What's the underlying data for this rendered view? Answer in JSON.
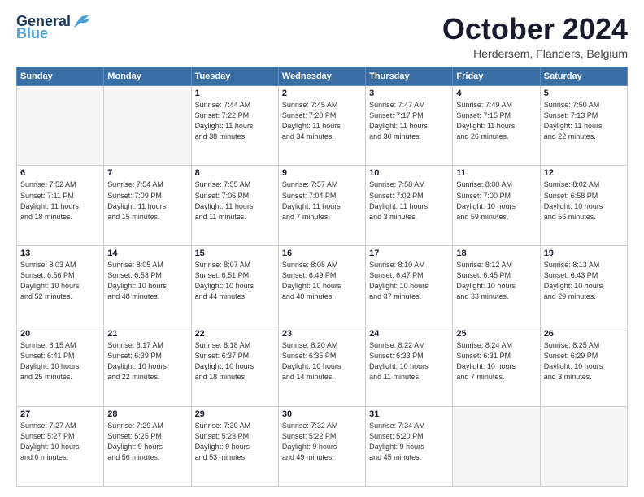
{
  "logo": {
    "line1": "General",
    "line1_accent": "Blue",
    "tagline": ""
  },
  "header": {
    "month": "October 2024",
    "location": "Herdersem, Flanders, Belgium"
  },
  "weekdays": [
    "Sunday",
    "Monday",
    "Tuesday",
    "Wednesday",
    "Thursday",
    "Friday",
    "Saturday"
  ],
  "weeks": [
    [
      {
        "day": "",
        "info": ""
      },
      {
        "day": "",
        "info": ""
      },
      {
        "day": "1",
        "info": "Sunrise: 7:44 AM\nSunset: 7:22 PM\nDaylight: 11 hours\nand 38 minutes."
      },
      {
        "day": "2",
        "info": "Sunrise: 7:45 AM\nSunset: 7:20 PM\nDaylight: 11 hours\nand 34 minutes."
      },
      {
        "day": "3",
        "info": "Sunrise: 7:47 AM\nSunset: 7:17 PM\nDaylight: 11 hours\nand 30 minutes."
      },
      {
        "day": "4",
        "info": "Sunrise: 7:49 AM\nSunset: 7:15 PM\nDaylight: 11 hours\nand 26 minutes."
      },
      {
        "day": "5",
        "info": "Sunrise: 7:50 AM\nSunset: 7:13 PM\nDaylight: 11 hours\nand 22 minutes."
      }
    ],
    [
      {
        "day": "6",
        "info": "Sunrise: 7:52 AM\nSunset: 7:11 PM\nDaylight: 11 hours\nand 18 minutes."
      },
      {
        "day": "7",
        "info": "Sunrise: 7:54 AM\nSunset: 7:09 PM\nDaylight: 11 hours\nand 15 minutes."
      },
      {
        "day": "8",
        "info": "Sunrise: 7:55 AM\nSunset: 7:06 PM\nDaylight: 11 hours\nand 11 minutes."
      },
      {
        "day": "9",
        "info": "Sunrise: 7:57 AM\nSunset: 7:04 PM\nDaylight: 11 hours\nand 7 minutes."
      },
      {
        "day": "10",
        "info": "Sunrise: 7:58 AM\nSunset: 7:02 PM\nDaylight: 11 hours\nand 3 minutes."
      },
      {
        "day": "11",
        "info": "Sunrise: 8:00 AM\nSunset: 7:00 PM\nDaylight: 10 hours\nand 59 minutes."
      },
      {
        "day": "12",
        "info": "Sunrise: 8:02 AM\nSunset: 6:58 PM\nDaylight: 10 hours\nand 56 minutes."
      }
    ],
    [
      {
        "day": "13",
        "info": "Sunrise: 8:03 AM\nSunset: 6:56 PM\nDaylight: 10 hours\nand 52 minutes."
      },
      {
        "day": "14",
        "info": "Sunrise: 8:05 AM\nSunset: 6:53 PM\nDaylight: 10 hours\nand 48 minutes."
      },
      {
        "day": "15",
        "info": "Sunrise: 8:07 AM\nSunset: 6:51 PM\nDaylight: 10 hours\nand 44 minutes."
      },
      {
        "day": "16",
        "info": "Sunrise: 8:08 AM\nSunset: 6:49 PM\nDaylight: 10 hours\nand 40 minutes."
      },
      {
        "day": "17",
        "info": "Sunrise: 8:10 AM\nSunset: 6:47 PM\nDaylight: 10 hours\nand 37 minutes."
      },
      {
        "day": "18",
        "info": "Sunrise: 8:12 AM\nSunset: 6:45 PM\nDaylight: 10 hours\nand 33 minutes."
      },
      {
        "day": "19",
        "info": "Sunrise: 8:13 AM\nSunset: 6:43 PM\nDaylight: 10 hours\nand 29 minutes."
      }
    ],
    [
      {
        "day": "20",
        "info": "Sunrise: 8:15 AM\nSunset: 6:41 PM\nDaylight: 10 hours\nand 25 minutes."
      },
      {
        "day": "21",
        "info": "Sunrise: 8:17 AM\nSunset: 6:39 PM\nDaylight: 10 hours\nand 22 minutes."
      },
      {
        "day": "22",
        "info": "Sunrise: 8:18 AM\nSunset: 6:37 PM\nDaylight: 10 hours\nand 18 minutes."
      },
      {
        "day": "23",
        "info": "Sunrise: 8:20 AM\nSunset: 6:35 PM\nDaylight: 10 hours\nand 14 minutes."
      },
      {
        "day": "24",
        "info": "Sunrise: 8:22 AM\nSunset: 6:33 PM\nDaylight: 10 hours\nand 11 minutes."
      },
      {
        "day": "25",
        "info": "Sunrise: 8:24 AM\nSunset: 6:31 PM\nDaylight: 10 hours\nand 7 minutes."
      },
      {
        "day": "26",
        "info": "Sunrise: 8:25 AM\nSunset: 6:29 PM\nDaylight: 10 hours\nand 3 minutes."
      }
    ],
    [
      {
        "day": "27",
        "info": "Sunrise: 7:27 AM\nSunset: 5:27 PM\nDaylight: 10 hours\nand 0 minutes."
      },
      {
        "day": "28",
        "info": "Sunrise: 7:29 AM\nSunset: 5:25 PM\nDaylight: 9 hours\nand 56 minutes."
      },
      {
        "day": "29",
        "info": "Sunrise: 7:30 AM\nSunset: 5:23 PM\nDaylight: 9 hours\nand 53 minutes."
      },
      {
        "day": "30",
        "info": "Sunrise: 7:32 AM\nSunset: 5:22 PM\nDaylight: 9 hours\nand 49 minutes."
      },
      {
        "day": "31",
        "info": "Sunrise: 7:34 AM\nSunset: 5:20 PM\nDaylight: 9 hours\nand 45 minutes."
      },
      {
        "day": "",
        "info": ""
      },
      {
        "day": "",
        "info": ""
      }
    ]
  ]
}
